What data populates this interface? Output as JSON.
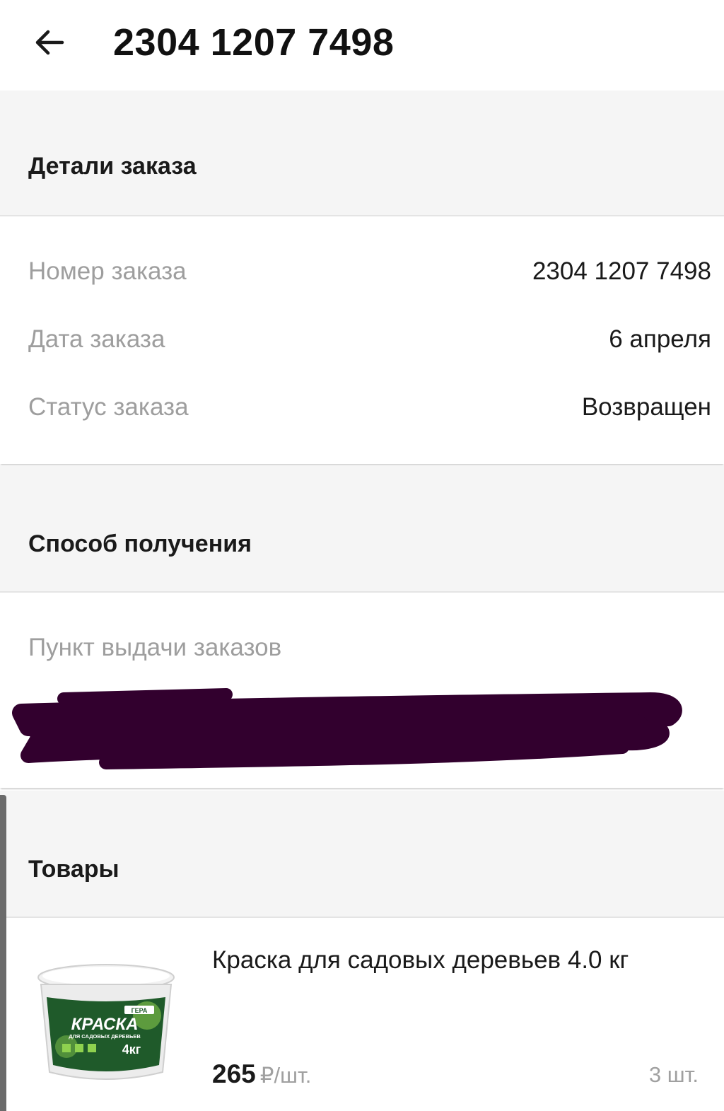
{
  "appbar": {
    "title": "2304 1207 7498",
    "back_icon": "arrow-left-icon"
  },
  "order_details": {
    "header": "Детали заказа",
    "rows": [
      {
        "label": "Номер заказа",
        "value": "2304 1207 7498"
      },
      {
        "label": "Дата заказа",
        "value": "6 апреля"
      },
      {
        "label": "Статус заказа",
        "value": "Возвращен"
      }
    ]
  },
  "delivery": {
    "header": "Способ получения",
    "pickup_label": "Пункт выдачи заказов",
    "redaction_color": "#32002e"
  },
  "products": {
    "header": "Товары",
    "items": [
      {
        "name": "Краска для садовых деревьев 4.0 кг",
        "price": "265",
        "price_unit": "₽/шт.",
        "quantity": "3 шт.",
        "image": {
          "brand": "ГЕРА",
          "title": "КРАСКА",
          "subtitle": "ДЛЯ САДОВЫХ ДЕРЕВЬЕВ",
          "weight": "4кг"
        }
      }
    ]
  },
  "colors": {
    "background": "#ffffff",
    "section_band": "#f5f5f5",
    "label_grey": "#9e9e9e",
    "text_primary": "#1a1a1a",
    "product_green": "#1f5a2a"
  }
}
